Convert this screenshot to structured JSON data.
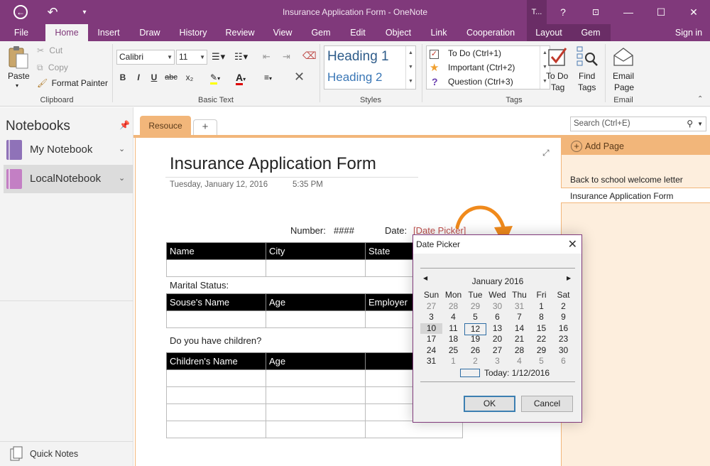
{
  "app": {
    "title": "Insurance Application Form - OneNote",
    "ctx_title": "T...",
    "help": "?",
    "restore": "⊡",
    "minimize": "—",
    "maximize": "☐",
    "close": "✕"
  },
  "tabs": [
    "File",
    "Home",
    "Insert",
    "Draw",
    "History",
    "Review",
    "View",
    "Gem",
    "Edit",
    "Object",
    "Link",
    "Cooperation",
    "Layout",
    "Gem"
  ],
  "signin": "Sign in",
  "clipboard": {
    "paste": "Paste",
    "cut": "Cut",
    "copy": "Copy",
    "format_painter": "Format Painter",
    "label": "Clipboard"
  },
  "basic_text": {
    "font": "Calibri",
    "size": "11",
    "label": "Basic Text",
    "bold": "B",
    "italic": "I",
    "underline": "U",
    "strike": "abc",
    "subscript": "x₂"
  },
  "styles": {
    "heading1": "Heading 1",
    "heading2": "Heading 2",
    "label": "Styles"
  },
  "tags": {
    "items": [
      "To Do (Ctrl+1)",
      "Important (Ctrl+2)",
      "Question (Ctrl+3)"
    ],
    "todo_tag": "To Do\nTag",
    "todo_l1": "To Do",
    "todo_l2": "Tag",
    "find_l1": "Find",
    "find_l2": "Tags",
    "label": "Tags"
  },
  "email": {
    "l1": "Email",
    "l2": "Page",
    "label": "Email"
  },
  "notebooks": {
    "header": "Notebooks",
    "items": [
      {
        "label": "My Notebook",
        "color": "#8f72b8"
      },
      {
        "label": "LocalNotebook",
        "color": "#c37fc4"
      }
    ],
    "quick_notes": "Quick Notes"
  },
  "section": {
    "tab": "Resouce",
    "add": "+"
  },
  "search": {
    "placeholder": "Search (Ctrl+E)"
  },
  "pages": {
    "add": "Add Page",
    "items": [
      "Back to school welcome letter",
      "Insurance Application Form"
    ]
  },
  "page": {
    "title": "Insurance Application Form",
    "date": "Tuesday, January 12, 2016",
    "time": "5:35 PM",
    "number_label": "Number:",
    "number_value": "####",
    "date_label": "Date:",
    "date_link": "[Date Picker]",
    "table1": [
      "Name",
      "City",
      "State"
    ],
    "marital": "Marital Status:",
    "table2": [
      "Souse's Name",
      "Age",
      "Employer"
    ],
    "children_q": "Do you have children?",
    "table3": [
      "Children's Name",
      "Age",
      ""
    ]
  },
  "datepicker": {
    "title": "Date Picker",
    "month": "January 2016",
    "weekdays": [
      "Sun",
      "Mon",
      "Tue",
      "Wed",
      "Thu",
      "Fri",
      "Sat"
    ],
    "weeks": [
      [
        "27",
        "28",
        "29",
        "30",
        "31",
        "1",
        "2"
      ],
      [
        "3",
        "4",
        "5",
        "6",
        "7",
        "8",
        "9"
      ],
      [
        "10",
        "11",
        "12",
        "13",
        "14",
        "15",
        "16"
      ],
      [
        "17",
        "18",
        "19",
        "20",
        "21",
        "22",
        "23"
      ],
      [
        "24",
        "25",
        "26",
        "27",
        "28",
        "29",
        "30"
      ],
      [
        "31",
        "1",
        "2",
        "3",
        "4",
        "5",
        "6"
      ]
    ],
    "today": "Today: 1/12/2016",
    "ok": "OK",
    "cancel": "Cancel"
  },
  "colors": {
    "brand": "#80397b",
    "section": "#f2b67a",
    "pagelist_bg": "#fdeedd",
    "arrow": "#f08a1c"
  }
}
